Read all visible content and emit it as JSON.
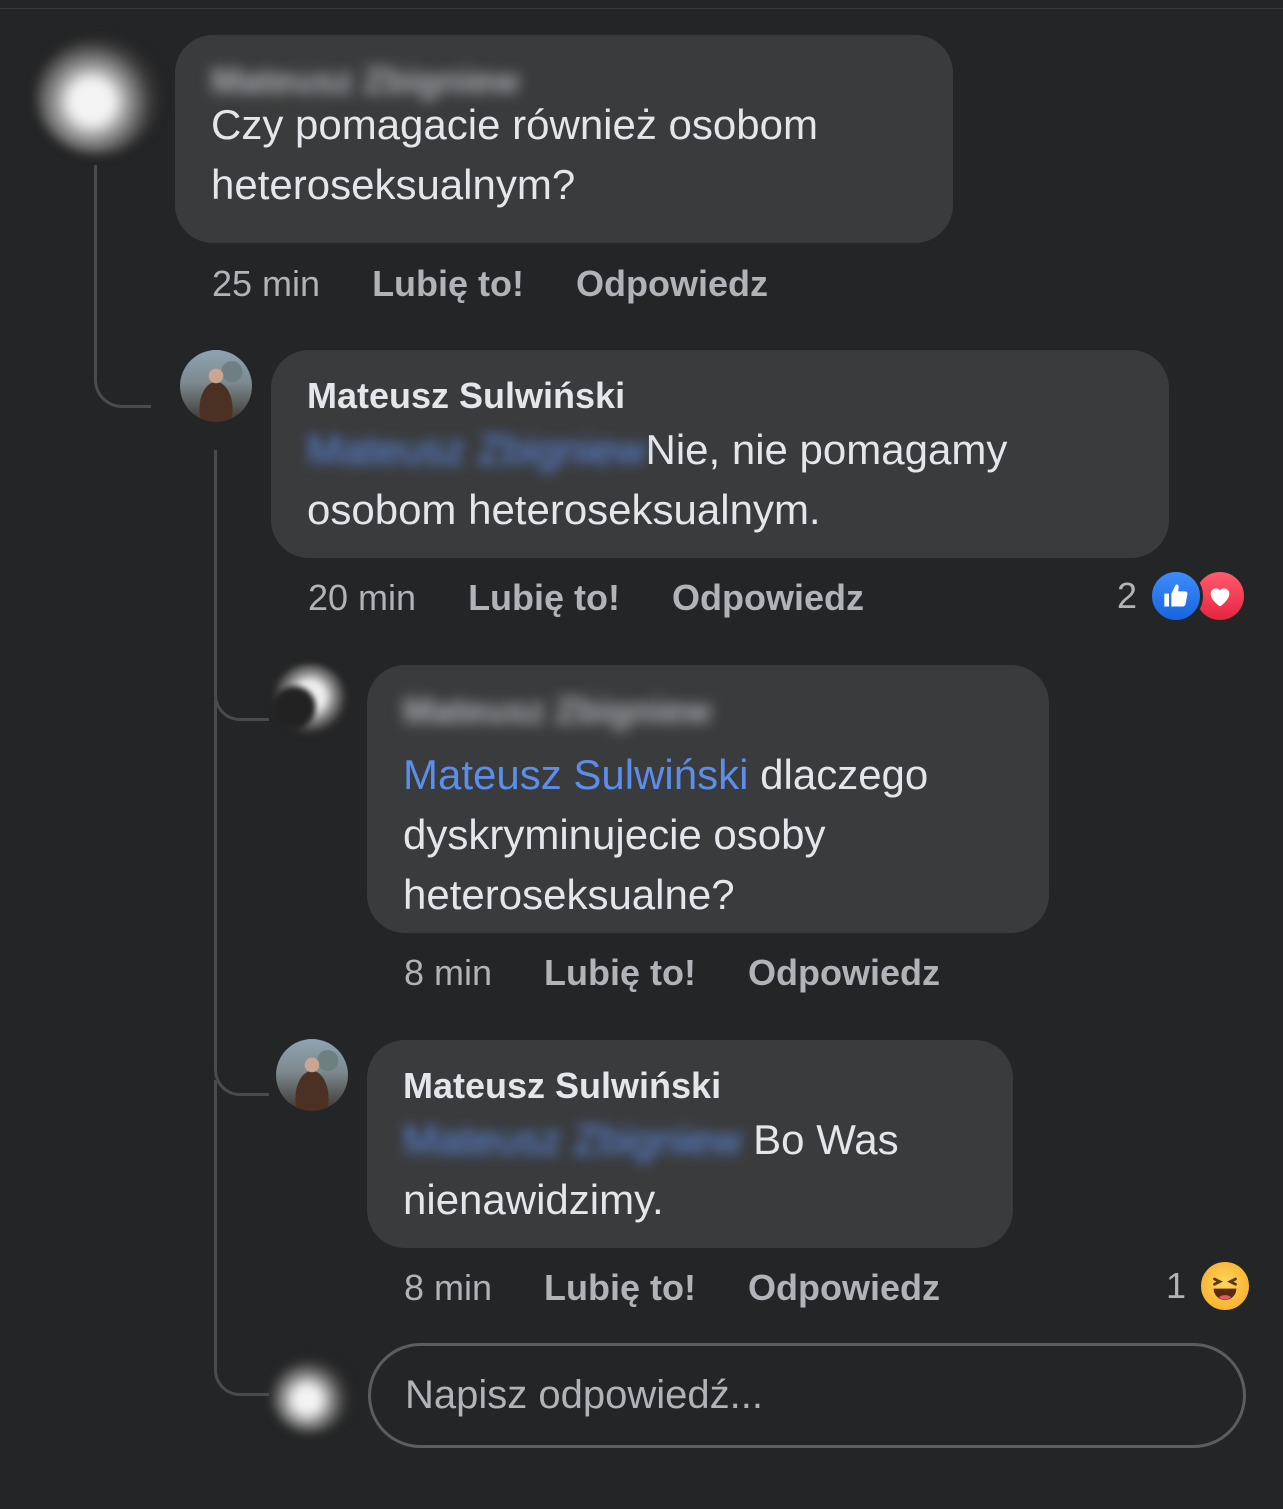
{
  "comments": [
    {
      "author": "Mateusz Zbigniew",
      "text": "Czy pomagacie również osobom heteroseksualnym?",
      "time": "25 min",
      "like_label": "Lubię to!",
      "reply_label": "Odpowiedz"
    },
    {
      "author": "Mateusz Sulwiński",
      "mention": "Mateusz Zbigniew",
      "text": "Nie, nie pomagamy osobom heteroseksualnym.",
      "time": "20 min",
      "like_label": "Lubię to!",
      "reply_label": "Odpowiedz",
      "reaction_count": "2",
      "reactions": [
        "like-icon",
        "love-icon"
      ]
    },
    {
      "author": "Mateusz Zbigniew",
      "mention": "Mateusz Sulwiński",
      "text": "dlaczego dyskryminujecie osoby heteroseksualne?",
      "time": "8 min",
      "like_label": "Lubię to!",
      "reply_label": "Odpowiedz"
    },
    {
      "author": "Mateusz Sulwiński",
      "mention": "Mateusz Zbigniew",
      "text": "Bo Was nienawidzimy.",
      "time": "8 min",
      "like_label": "Lubię to!",
      "reply_label": "Odpowiedz",
      "reaction_count": "1",
      "reactions": [
        "haha-icon"
      ]
    }
  ],
  "reply_box": {
    "placeholder": "Napisz odpowiedź..."
  },
  "colors": {
    "background": "#242526",
    "bubble": "#3a3b3c",
    "mention": "#5b8eeb",
    "secondary_text": "#b0b3b8"
  }
}
